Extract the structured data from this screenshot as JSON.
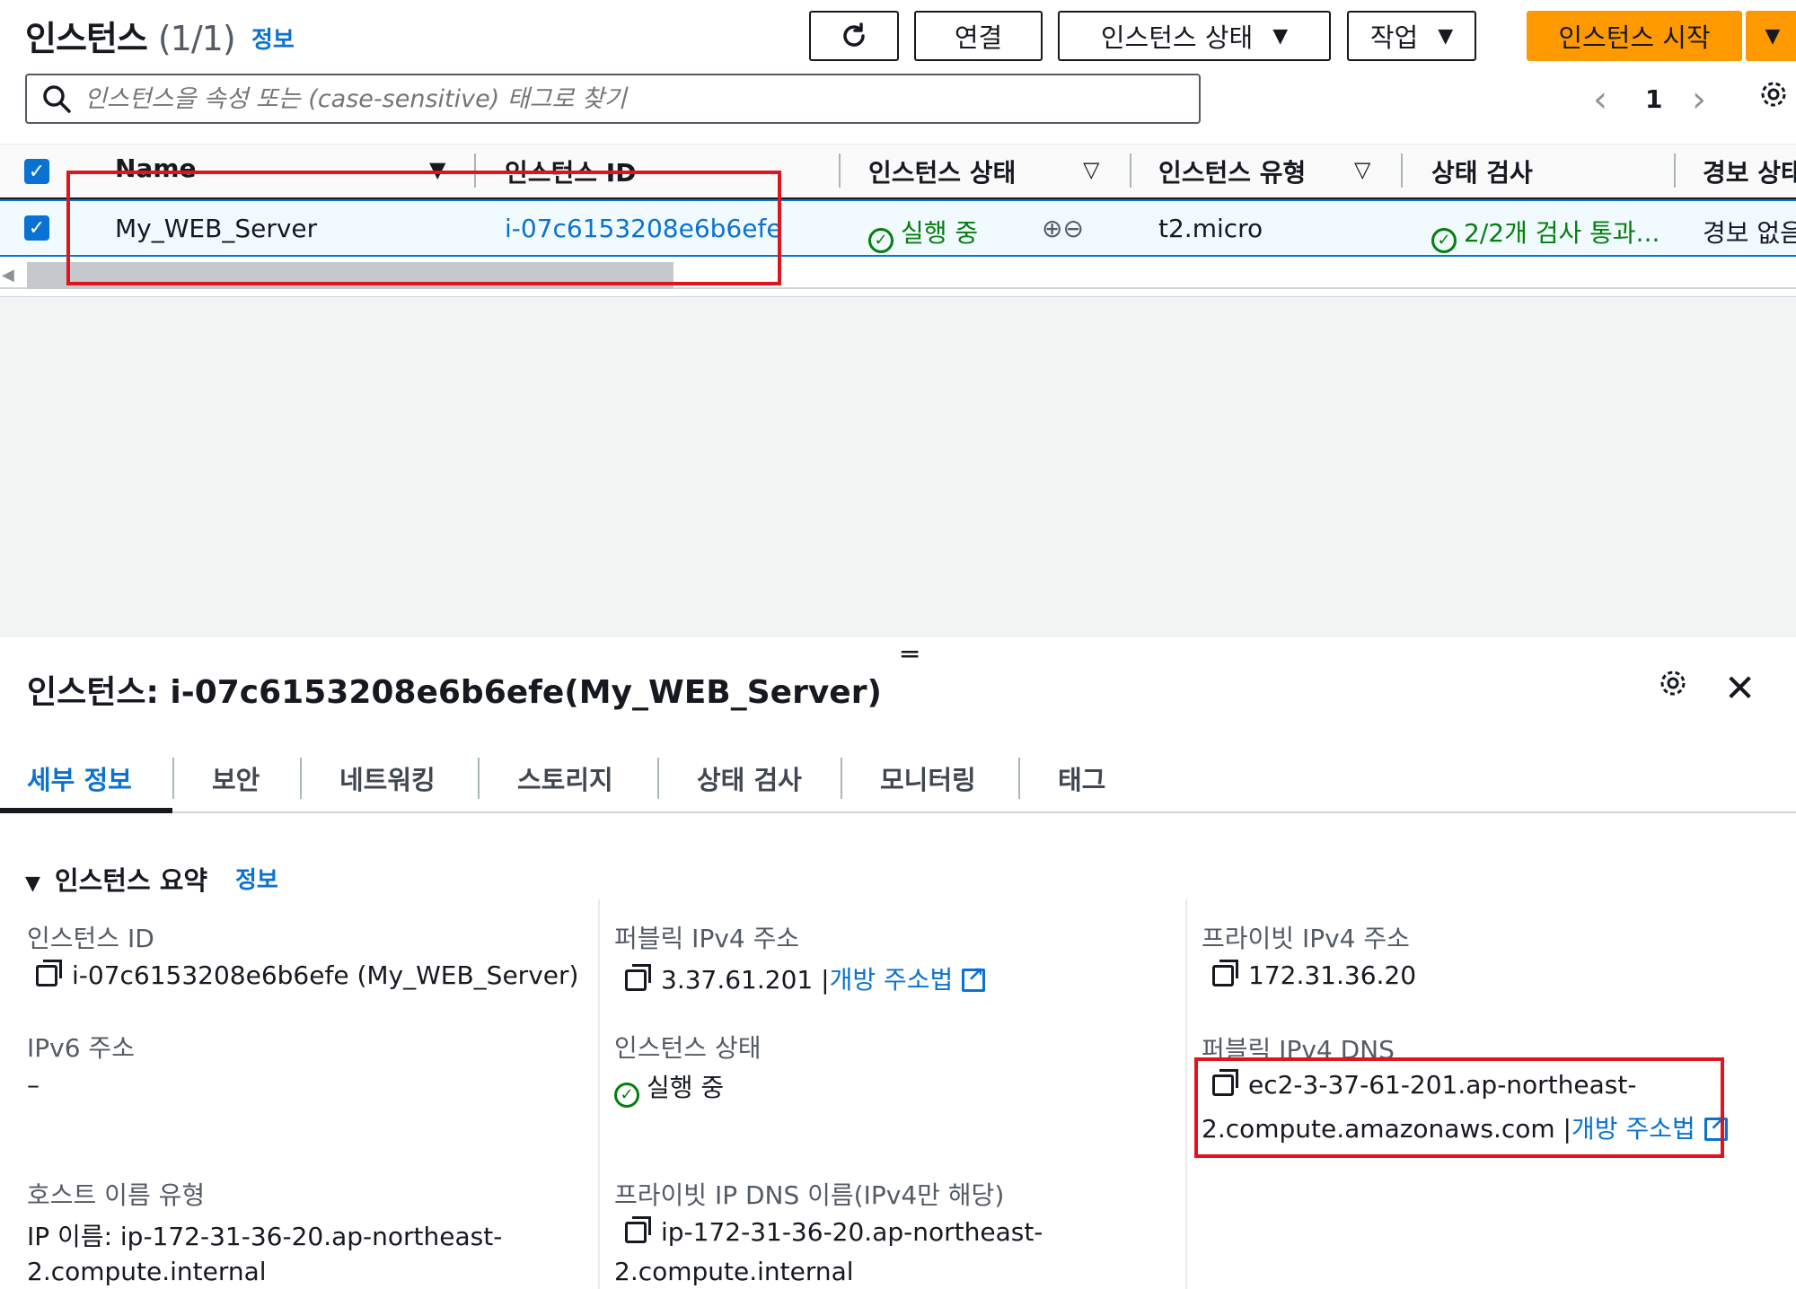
{
  "header": {
    "title": "인스턴스",
    "count": "(1/1)",
    "info": "정보",
    "buttons": {
      "refresh_icon": "refresh-icon",
      "connect": "연결",
      "instance_state": "인스턴스 상태",
      "actions": "작업",
      "launch": "인스턴스 시작"
    }
  },
  "search": {
    "placeholder": "인스턴스을 속성 또는 (case-sensitive) 태그로 찾기"
  },
  "pagination": {
    "prev": "‹",
    "page": "1",
    "next": "›"
  },
  "table": {
    "columns": [
      "Name",
      "인스턴스 ID",
      "인스턴스 상태",
      "인스턴스 유형",
      "상태 검사",
      "경보 상태"
    ],
    "rows": [
      {
        "name": "My_WEB_Server",
        "instance_id": "i-07c6153208e6b6efe",
        "state": "실행 중",
        "type": "t2.micro",
        "status_check": "2/2개 검사 통과...",
        "alarm": "경보 없음"
      }
    ]
  },
  "details": {
    "title": "인스턴스: i-07c6153208e6b6efe(My_WEB_Server)",
    "tabs": [
      "세부 정보",
      "보안",
      "네트워킹",
      "스토리지",
      "상태 검사",
      "모니터링",
      "태그"
    ],
    "summary_header": "인스턴스 요약",
    "summary_info": "정보",
    "fields": {
      "instance_id_label": "인스턴스 ID",
      "instance_id_value": "i-07c6153208e6b6efe (My_WEB_Server)",
      "public_ipv4_label": "퍼블릭 IPv4 주소",
      "public_ipv4_value": "3.37.61.201",
      "open_address_link": "개방 주소법",
      "private_ipv4_label": "프라이빗 IPv4 주소",
      "private_ipv4_value": "172.31.36.20",
      "ipv6_label": "IPv6 주소",
      "ipv6_value": "–",
      "instance_state_label": "인스턴스 상태",
      "instance_state_value": "실행 중",
      "public_dns_label": "퍼블릭 IPv4 DNS",
      "public_dns_line1": "ec2-3-37-61-201.ap-northeast-",
      "public_dns_line2": "2.compute.amazonaws.com",
      "hostname_type_label": "호스트 이름 유형",
      "hostname_type_line1": "IP 이름: ip-172-31-36-20.ap-northeast-",
      "hostname_type_line2": "2.compute.internal",
      "private_dns_label": "프라이빗 IP DNS 이름(IPv4만 해당)",
      "private_dns_line1": "ip-172-31-36-20.ap-northeast-",
      "private_dns_line2": "2.compute.internal"
    }
  },
  "colors": {
    "primary": "#ff9900",
    "link": "#0972d3",
    "success": "#037f0c",
    "highlight": "#e0141e"
  }
}
